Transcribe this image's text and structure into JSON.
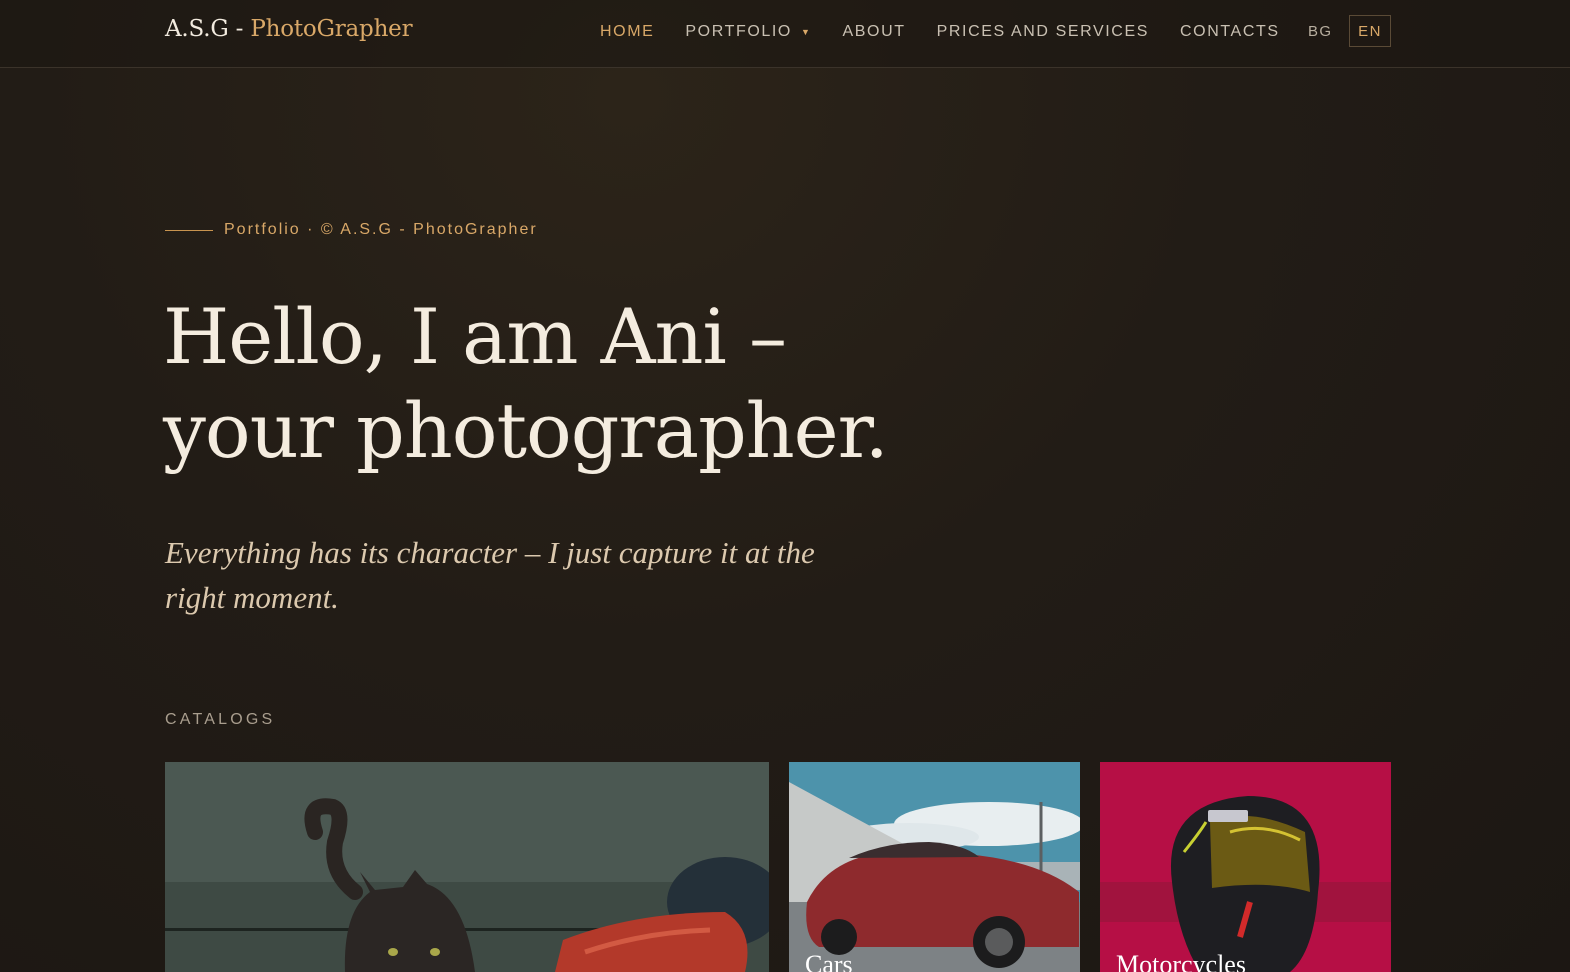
{
  "header": {
    "logo_main": "A.S.G - ",
    "logo_accent": "PhotoGrapher",
    "nav": [
      {
        "label": "HOME"
      },
      {
        "label": "PORTFOLIO"
      },
      {
        "label": "ABOUT"
      },
      {
        "label": "PRICES AND SERVICES"
      },
      {
        "label": "CONTACTS"
      }
    ],
    "lang_bg": "BG",
    "lang_en": "EN"
  },
  "hero": {
    "kicker": "Portfolio · © A.S.G - PhotoGrapher",
    "headline_line1": "Hello, I am Ani –",
    "headline_line2": "your photographer.",
    "tagline": "Everything has its character – I just capture it at the right moment."
  },
  "catalogs": {
    "label": "CATALOGS",
    "items": [
      {
        "title": ""
      },
      {
        "title": "Cars"
      },
      {
        "title": "Motorcycles"
      }
    ]
  },
  "colors": {
    "accent": "#d9a868",
    "background": "#221c16",
    "text": "#f4ecdf"
  }
}
